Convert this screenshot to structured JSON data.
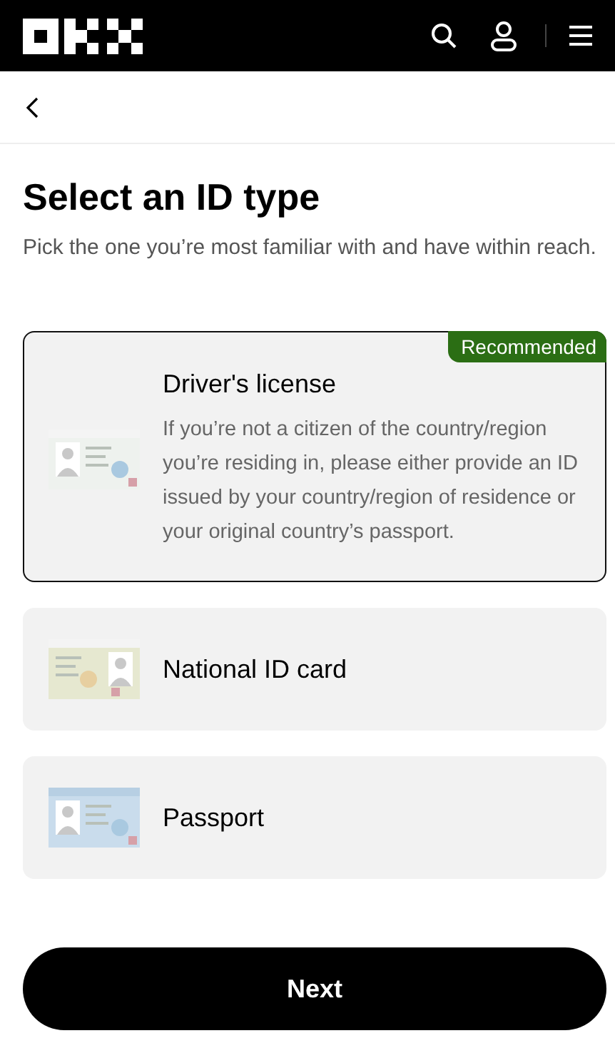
{
  "title": "Select an ID type",
  "subtitle": "Pick the one you’re most familiar with and have within reach.",
  "options": [
    {
      "label": "Driver's license",
      "selected": true,
      "badge": "Recommended",
      "description": "If you’re not a citizen of the country/region you’re residing in, please either provide an ID issued by your country/region of residence or your original country’s passport.",
      "kind": "license"
    },
    {
      "label": "National ID card",
      "selected": false,
      "kind": "national"
    },
    {
      "label": "Passport",
      "selected": false,
      "kind": "passport"
    }
  ],
  "next_button": "Next"
}
